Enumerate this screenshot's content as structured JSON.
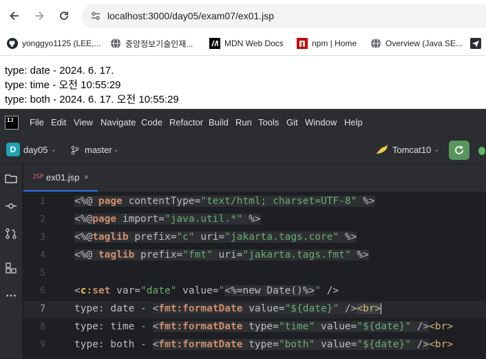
{
  "browser": {
    "url": "localhost:3000/day05/exam07/ex01.jsp",
    "bookmarks": [
      {
        "label": "yonggyo1125 (LEE,...",
        "icon": "github-icon"
      },
      {
        "label": "중앙정보기술인재...",
        "icon": "globe-icon"
      },
      {
        "label": "MDN Web Docs",
        "icon": "mdn-icon"
      },
      {
        "label": "npm | Home",
        "icon": "npm-icon"
      },
      {
        "label": "Overview (Java SE...",
        "icon": "globe-icon"
      }
    ]
  },
  "output": {
    "lines": [
      "type: date - 2024. 6. 17.",
      "type: time - 오전 10:55:29",
      "type: both - 2024. 6. 17. 오전 10:55:29"
    ]
  },
  "ide": {
    "logo": "IJ",
    "menu": [
      "File",
      "Edit",
      "View",
      "Navigate",
      "Code",
      "Refactor",
      "Build",
      "Run",
      "Tools",
      "Git",
      "Window",
      "Help"
    ],
    "project_badge": "D",
    "project": "day05",
    "branch": "master",
    "run_config": "Tomcat10",
    "tab": {
      "badge": "JSP",
      "name": "ex01.jsp",
      "close": "×"
    },
    "line_numbers": [
      "1",
      "2",
      "3",
      "4",
      "5",
      "6",
      "7",
      "8",
      "9"
    ],
    "active_line": "7",
    "code": {
      "l1": {
        "open": "<%@ ",
        "kw": "page",
        "a1": " contentType=",
        "s1": "\"text/html; charset=UTF-8\"",
        "close": " %>"
      },
      "l2": {
        "open": "<%@",
        "kw": "page",
        "a1": " import=",
        "s1": "\"java.util.*\"",
        "close": " %>"
      },
      "l3": {
        "open": "<%@",
        "kw": "taglib",
        "a1": " prefix=",
        "s1": "\"c\"",
        "a2": " uri=",
        "s2": "\"jakarta.tags.core\"",
        "close": " %>"
      },
      "l4": {
        "open": "<%@ ",
        "kw": "taglib",
        "a1": " prefix=",
        "s1": "\"fmt\"",
        "a2": " uri=",
        "s2": "\"jakarta.tags.fmt\"",
        "close": " %>"
      },
      "l6": {
        "open": "<",
        "ns": "c",
        "tag": ":set",
        "a1": " var=",
        "s1": "\"date\"",
        "a2": " value=",
        "s2a": "\"",
        "expr": "<%=new Date()%>",
        "s2b": "\"",
        "close": " />"
      },
      "l7": {
        "text": "type: date - ",
        "open": "<",
        "ns": "fmt",
        "tag": ":formatDate",
        "a1": " value=",
        "s1": "\"${date}\"",
        "close": " />",
        "br": "<br>"
      },
      "l8": {
        "text": "type: time - ",
        "open": "<",
        "ns": "fmt",
        "tag": ":formatDate",
        "a1": " type=",
        "s1": "\"time\"",
        "a2": " value=",
        "s2": "\"${date}\"",
        "close": " />",
        "br": "<br>"
      },
      "l9": {
        "text": "type: both - ",
        "open": "<",
        "ns": "fmt",
        "tag": ":formatDate",
        "a1": " type=",
        "s1": "\"both\"",
        "a2": " value=",
        "s2": "\"${date}\"",
        "close": " />",
        "br": "<br>"
      }
    }
  }
}
